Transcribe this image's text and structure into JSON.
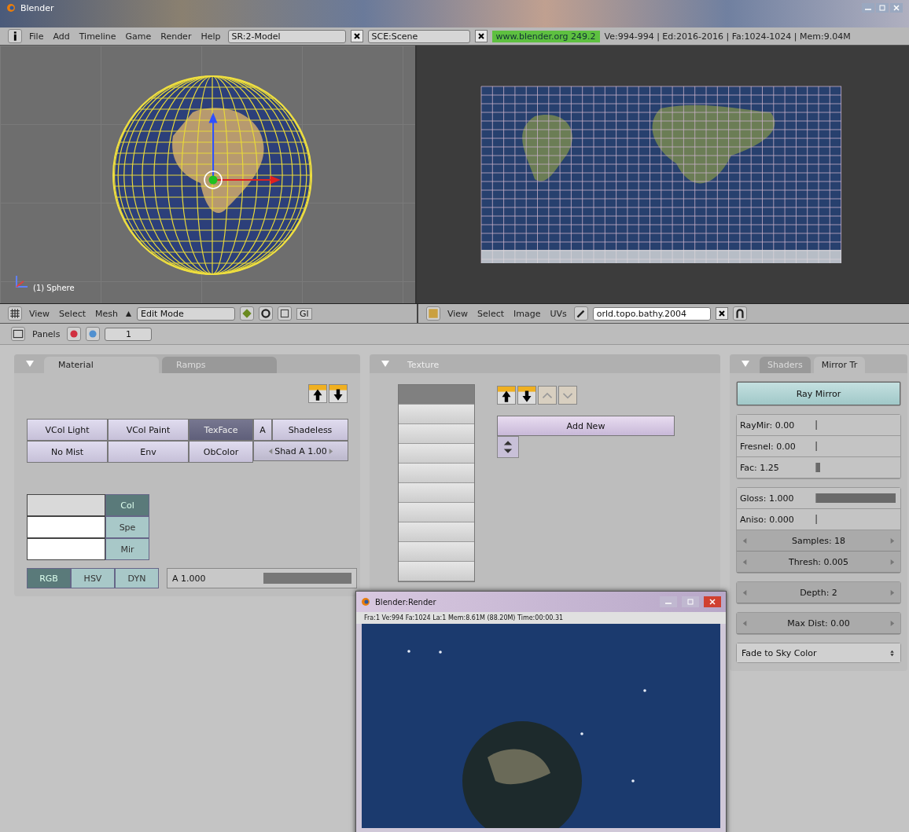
{
  "window": {
    "title": "Blender"
  },
  "menu_bar": {
    "menus": [
      "File",
      "Add",
      "Timeline",
      "Game",
      "Render",
      "Help"
    ],
    "screen": "SR:2-Model",
    "scene": "SCE:Scene",
    "version": "www.blender.org 249.2",
    "stats": "Ve:994-994 | Ed:2016-2016 | Fa:1024-1024 | Mem:9.04M"
  },
  "view3d": {
    "object_label": "(1) Sphere",
    "header": {
      "menus": [
        "View",
        "Select",
        "Mesh"
      ],
      "mode": "Edit Mode",
      "layer": "Gl"
    }
  },
  "uv_editor": {
    "header": {
      "menus": [
        "View",
        "Select",
        "Image",
        "UVs"
      ],
      "image": "orld.topo.bathy.2004"
    }
  },
  "buttons_header": {
    "label": "Panels",
    "frame": "1"
  },
  "material_panel": {
    "tabs": [
      {
        "label": "Material",
        "selected": true
      },
      {
        "label": "Ramps",
        "selected": false
      }
    ],
    "toggles": [
      {
        "kind": "toggle",
        "label": "VCol Light",
        "on": false
      },
      {
        "kind": "toggle",
        "label": "VCol Paint",
        "on": false
      },
      {
        "kind": "toggle",
        "label": "TexFace",
        "on": true
      },
      {
        "kind": "toggle",
        "label": "A",
        "on": false
      },
      {
        "kind": "toggle",
        "label": "Shadeless",
        "on": false
      },
      {
        "kind": "toggle",
        "label": "No Mist",
        "on": false
      },
      {
        "kind": "toggle",
        "label": "Env",
        "on": false
      },
      {
        "kind": "toggle",
        "label": "ObColor",
        "on": false
      },
      {
        "kind": "number",
        "label": "Shad A 1.00"
      }
    ],
    "color_slots": [
      {
        "label": "Col",
        "selected": true
      },
      {
        "label": "Spe",
        "selected": false
      },
      {
        "label": "Mir",
        "selected": false
      }
    ],
    "color_models": [
      {
        "label": "RGB",
        "selected": true
      },
      {
        "label": "HSV",
        "selected": false
      },
      {
        "label": "DYN",
        "selected": false
      }
    ],
    "alpha": {
      "label": "A 1.000",
      "level": 1
    }
  },
  "texture_panel": {
    "tabs": [
      {
        "label": "Texture"
      }
    ],
    "slots": [
      {
        "selected": true
      },
      {
        "selected": false
      },
      {
        "selected": false
      },
      {
        "selected": false
      },
      {
        "selected": false
      },
      {
        "selected": false
      },
      {
        "selected": false
      },
      {
        "selected": false
      },
      {
        "selected": false
      },
      {
        "selected": false
      }
    ],
    "add_button": "Add New"
  },
  "shaders_panel": {
    "tabs": [
      {
        "label": "Shaders",
        "selected": false
      },
      {
        "label": "Mirror Tr",
        "selected": true
      }
    ],
    "groups": [
      [
        {
          "kind": "toggle",
          "label": "Ray Mirror",
          "on": true
        }
      ],
      [
        {
          "kind": "slider",
          "label": "RayMir: 0.00",
          "level": 0
        },
        {
          "kind": "slider",
          "label": "Fresnel: 0.00",
          "level": 0
        },
        {
          "kind": "slider",
          "label": "Fac: 1.25",
          "level": 0.05
        }
      ],
      [
        {
          "kind": "slider",
          "label": "Gloss: 1.000",
          "level": 1
        },
        {
          "kind": "slider",
          "label": "Aniso: 0.000",
          "level": 0
        },
        {
          "kind": "number",
          "label": "Samples: 18"
        },
        {
          "kind": "number",
          "label": "Thresh: 0.005"
        }
      ],
      [
        {
          "kind": "number",
          "label": "Depth: 2"
        }
      ],
      [
        {
          "kind": "number",
          "label": "Max Dist: 0.00"
        }
      ],
      [
        {
          "kind": "menu",
          "label": "Fade to Sky Color"
        }
      ]
    ]
  },
  "render_window": {
    "title": "Blender:Render",
    "status": "Fra:1  Ve:994 Fa:1024 La:1 Mem:8.61M (88.20M) Time:00:00.31"
  }
}
